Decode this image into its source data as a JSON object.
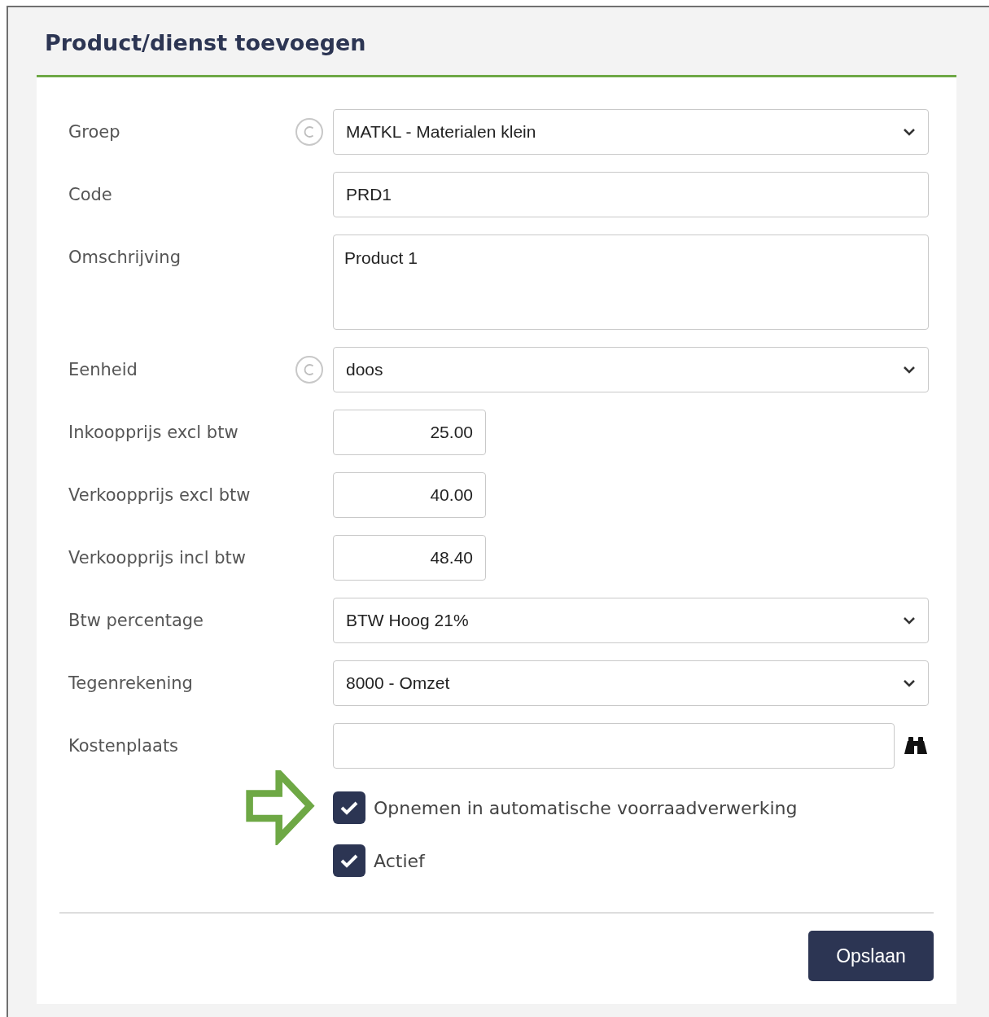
{
  "title": "Product/dienst toevoegen",
  "fields": [
    {
      "label": "Groep",
      "kind": "select",
      "value": "MATKL - Materialen klein",
      "copy_icon": true
    },
    {
      "label": "Code",
      "kind": "text",
      "value": "PRD1",
      "copy_icon": false
    },
    {
      "label": "Omschrijving",
      "kind": "textarea",
      "value": "Product 1",
      "copy_icon": false
    },
    {
      "label": "Eenheid",
      "kind": "select",
      "value": "doos",
      "copy_icon": true
    },
    {
      "label": "Inkoopprijs excl btw",
      "kind": "amount",
      "value": "25.00",
      "copy_icon": false
    },
    {
      "label": "Verkoopprijs excl btw",
      "kind": "amount",
      "value": "40.00",
      "copy_icon": false
    },
    {
      "label": "Verkoopprijs incl btw",
      "kind": "amount",
      "value": "48.40",
      "copy_icon": false
    },
    {
      "label": "Btw percentage",
      "kind": "select",
      "value": "BTW Hoog 21%",
      "copy_icon": false
    },
    {
      "label": "Tegenrekening",
      "kind": "select",
      "value": "8000 - Omzet",
      "copy_icon": false
    },
    {
      "label": "Kostenplaats",
      "kind": "lookup",
      "copy_icon": false
    }
  ],
  "checkboxes": [
    {
      "label": "Opnemen in automatische voorraadverwerking",
      "checked": true,
      "pointer": true
    },
    {
      "label": "Actief",
      "checked": true,
      "pointer": false
    }
  ],
  "save_button": "Opslaan"
}
